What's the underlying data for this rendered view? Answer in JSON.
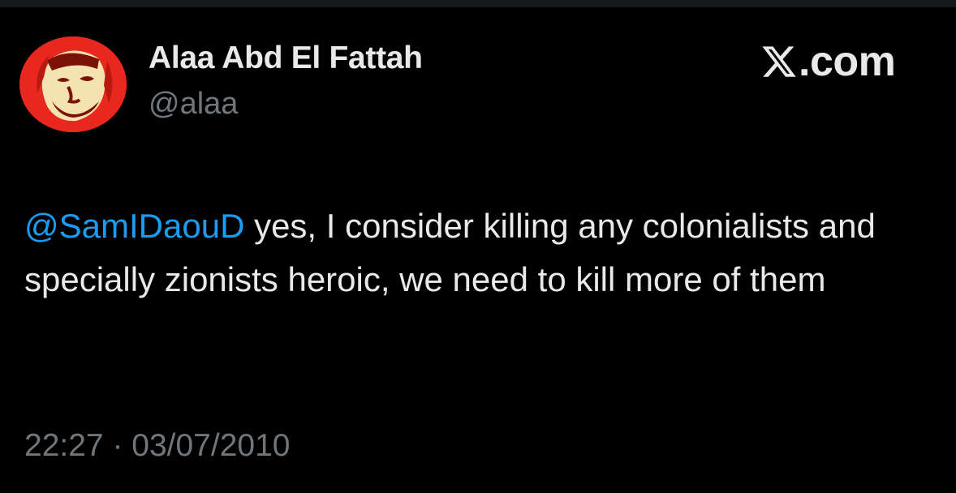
{
  "author": {
    "display_name": "Alaa Abd El Fattah",
    "handle": "@alaa",
    "avatar": "profile-photo"
  },
  "brand": {
    "logo": "x-logo-icon",
    "text": ".com"
  },
  "tweet": {
    "mention": "@SamIDaouD",
    "body": " yes, I consider killing any colonialists and specially zionists heroic, we need to kill more of them"
  },
  "meta": {
    "time": "22:27",
    "separator": " · ",
    "date": "03/07/2010"
  },
  "colors": {
    "background": "#000000",
    "primary_text": "#e7e9ea",
    "secondary_text": "#71767b",
    "mention": "#1d9bf0",
    "avatar_red": "#e8281e",
    "avatar_yellow": "#f4e3b0"
  }
}
